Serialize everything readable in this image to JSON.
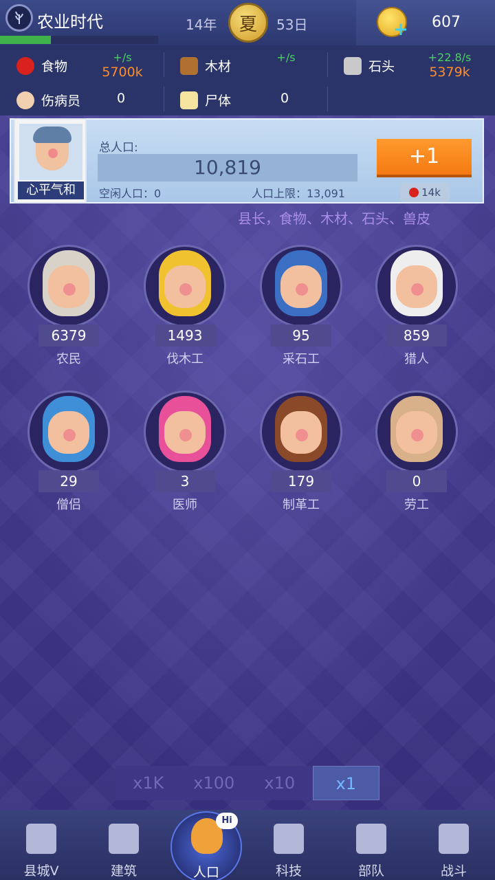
{
  "header": {
    "era": "农业时代",
    "year": "14年",
    "season": "夏",
    "day": "53日",
    "gold": "607",
    "era_progress": 0.32
  },
  "resources": {
    "food": {
      "label": "食物",
      "rate": "+/s",
      "value": "5700k"
    },
    "wood": {
      "label": "木材",
      "rate": "+/s"
    },
    "stone": {
      "label": "石头",
      "rate": "+22.8/s",
      "value": "5379k"
    },
    "wounded": {
      "label": "伤病员",
      "value": "0"
    },
    "corpses": {
      "label": "尸体",
      "value": "0"
    }
  },
  "population": {
    "mood": "心平气和",
    "total_label": "总人口:",
    "total": "10,819",
    "idle": "空闲人口：0",
    "cap": "人口上限：13,091",
    "add_button": "+1",
    "cost": "14k",
    "ticker": "县长，食物、木材、石头、兽皮"
  },
  "jobs": [
    {
      "name": "农民",
      "count": "6379",
      "hair": "#d9d2c8"
    },
    {
      "name": "伐木工",
      "count": "1493",
      "hair": "#f0c230"
    },
    {
      "name": "采石工",
      "count": "95",
      "hair": "#3b6fc4"
    },
    {
      "name": "猎人",
      "count": "859",
      "hair": "#eeeeee"
    },
    {
      "name": "僧侣",
      "count": "29",
      "hair": "#3f8fd8"
    },
    {
      "name": "医师",
      "count": "3",
      "hair": "#e8509a"
    },
    {
      "name": "制革工",
      "count": "179",
      "hair": "#8a4a2a"
    },
    {
      "name": "劳工",
      "count": "0",
      "hair": "#d8b08a"
    }
  ],
  "multiplier": {
    "options": [
      "x1K",
      "x100",
      "x10",
      "x1"
    ],
    "selected": "x1"
  },
  "nav": [
    {
      "label": "县城V",
      "icon": "castle-icon"
    },
    {
      "label": "建筑",
      "icon": "house-icon"
    },
    {
      "label": "人口",
      "icon": "person-icon",
      "badge": "Hi"
    },
    {
      "label": "科技",
      "icon": "book-icon"
    },
    {
      "label": "部队",
      "icon": "banner-icon"
    },
    {
      "label": "战斗",
      "icon": "swords-icon"
    }
  ],
  "colors": {
    "accent": "#ff8d2a",
    "rate_green": "#49d25e",
    "background": "#3d3582"
  }
}
